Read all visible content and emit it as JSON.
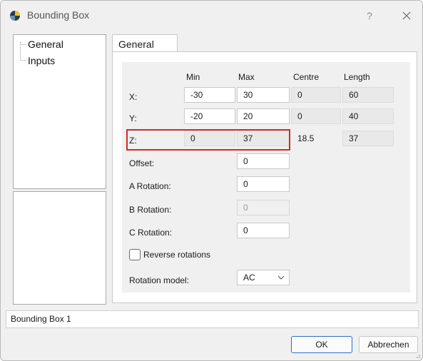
{
  "window": {
    "title": "Bounding Box",
    "help_glyph": "?"
  },
  "tree": {
    "items": [
      {
        "label": "General"
      },
      {
        "label": "Inputs"
      }
    ]
  },
  "tab": {
    "label": "General"
  },
  "columns": {
    "min": "Min",
    "max": "Max",
    "centre": "Centre",
    "length": "Length"
  },
  "rows": {
    "x": {
      "label": "X:",
      "min": "-30",
      "max": "30",
      "centre": "0",
      "length": "60"
    },
    "y": {
      "label": "Y:",
      "min": "-20",
      "max": "20",
      "centre": "0",
      "length": "40"
    },
    "z": {
      "label": "Z:",
      "min": "0",
      "max": "37",
      "centre": "18.5",
      "length": "37"
    }
  },
  "fields": {
    "offset": {
      "label": "Offset:",
      "value": "0"
    },
    "a_rotation": {
      "label": "A Rotation:",
      "value": "0"
    },
    "b_rotation": {
      "label": "B Rotation:",
      "value": "0"
    },
    "c_rotation": {
      "label": "C Rotation:",
      "value": "0"
    }
  },
  "reverse_rotations": {
    "label": "Reverse rotations",
    "checked": false
  },
  "rotation_model": {
    "label": "Rotation model:",
    "value": "AC"
  },
  "status": {
    "text": "Bounding Box 1"
  },
  "buttons": {
    "ok": "OK",
    "cancel": "Abbrechen"
  },
  "colors": {
    "highlight": "#d12a2a",
    "primary_border": "#2b6fc9"
  },
  "icons": {
    "app": "app-logo-icon",
    "close": "close-icon",
    "dropdown": "chevron-down-icon"
  }
}
